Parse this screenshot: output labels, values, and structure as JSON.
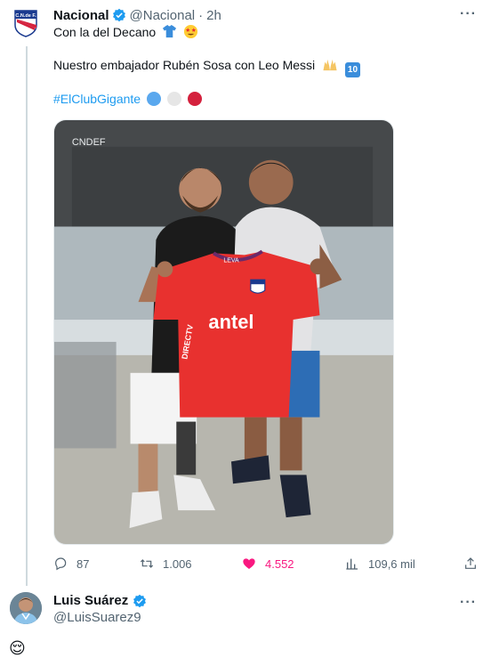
{
  "tweet": {
    "author_name": "Nacional",
    "author_handle": "@Nacional",
    "separator": "·",
    "time": "2h",
    "more_label": "···",
    "line1_text": "Con la del Decano",
    "line2_text": "Nuestro embajador Rubén Sosa con Leo Messi",
    "line2_emoji": "10",
    "hashtag": "#ElClubGigante",
    "flag_colors": [
      "#5aa8ee",
      "#e6e6e6",
      "#d4213d"
    ],
    "photo": {
      "corner_mark": "CNDEF",
      "shirt_sponsor": "antel",
      "shirt_sponsor_side": "DIRECTV",
      "shirt_collar": "LEVA"
    }
  },
  "stats": {
    "replies": "87",
    "retweets": "1.006",
    "likes": "4.552",
    "views": "109,6 mil"
  },
  "reply": {
    "author_name": "Luis Suárez",
    "author_handle": "@LuisSuarez9",
    "more_label": "···",
    "emoji": "😌"
  },
  "colors": {
    "accent": "#1d9bf0",
    "like": "#f91880",
    "muted": "#536471",
    "shirt_red": "#e8312f"
  },
  "icons": {
    "verified": "verified-badge-icon",
    "reply": "reply-icon",
    "retweet": "retweet-icon",
    "like": "heart-icon",
    "views": "views-chart-icon",
    "share": "share-icon"
  }
}
